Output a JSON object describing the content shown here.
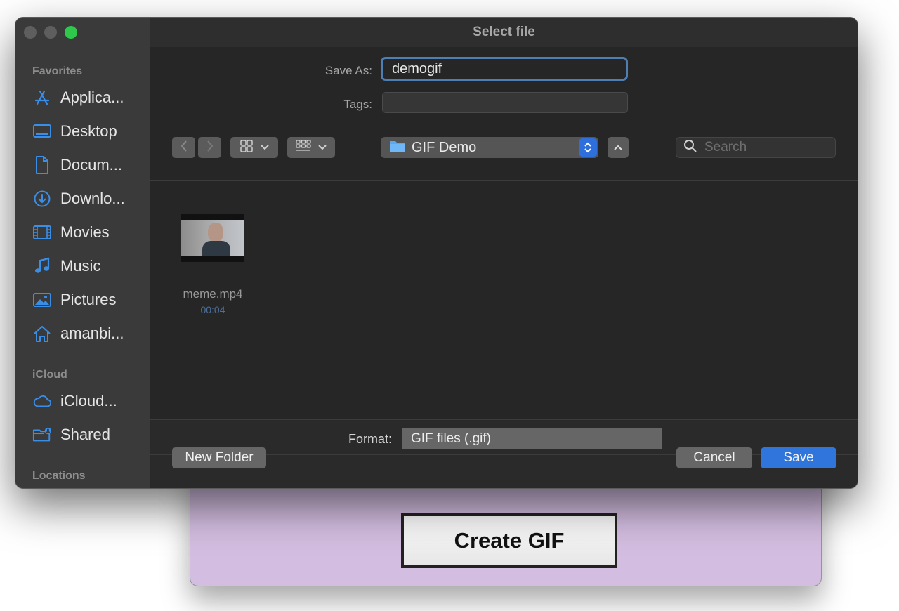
{
  "background_app": {
    "create_gif_label": "Create GIF"
  },
  "dialog": {
    "title": "Select file",
    "save_as_label": "Save As:",
    "save_as_value": "demogif",
    "tags_label": "Tags:",
    "current_folder": "GIF Demo",
    "search_placeholder": "Search",
    "format_label": "Format:",
    "format_value": "GIF files (.gif)",
    "new_folder_label": "New Folder",
    "cancel_label": "Cancel",
    "save_label": "Save"
  },
  "sidebar": {
    "favorites_label": "Favorites",
    "favorites": [
      {
        "label": "Applica...",
        "icon": "applications-icon"
      },
      {
        "label": "Desktop",
        "icon": "desktop-icon"
      },
      {
        "label": "Docum...",
        "icon": "document-icon"
      },
      {
        "label": "Downlo...",
        "icon": "download-icon"
      },
      {
        "label": "Movies",
        "icon": "film-icon"
      },
      {
        "label": "Music",
        "icon": "music-icon"
      },
      {
        "label": "Pictures",
        "icon": "pictures-icon"
      },
      {
        "label": "amanbi...",
        "icon": "home-icon"
      }
    ],
    "icloud_label": "iCloud",
    "icloud": [
      {
        "label": "iCloud...",
        "icon": "cloud-icon"
      },
      {
        "label": "Shared",
        "icon": "shared-folder-icon"
      }
    ],
    "locations_label": "Locations"
  },
  "files": [
    {
      "name": "meme.mp4",
      "duration": "00:04"
    }
  ],
  "colors": {
    "accent": "#2f75db",
    "sidebar_icon": "#3b8ee8",
    "dialog_bg": "#262626",
    "background_app": "#d3bde0"
  }
}
